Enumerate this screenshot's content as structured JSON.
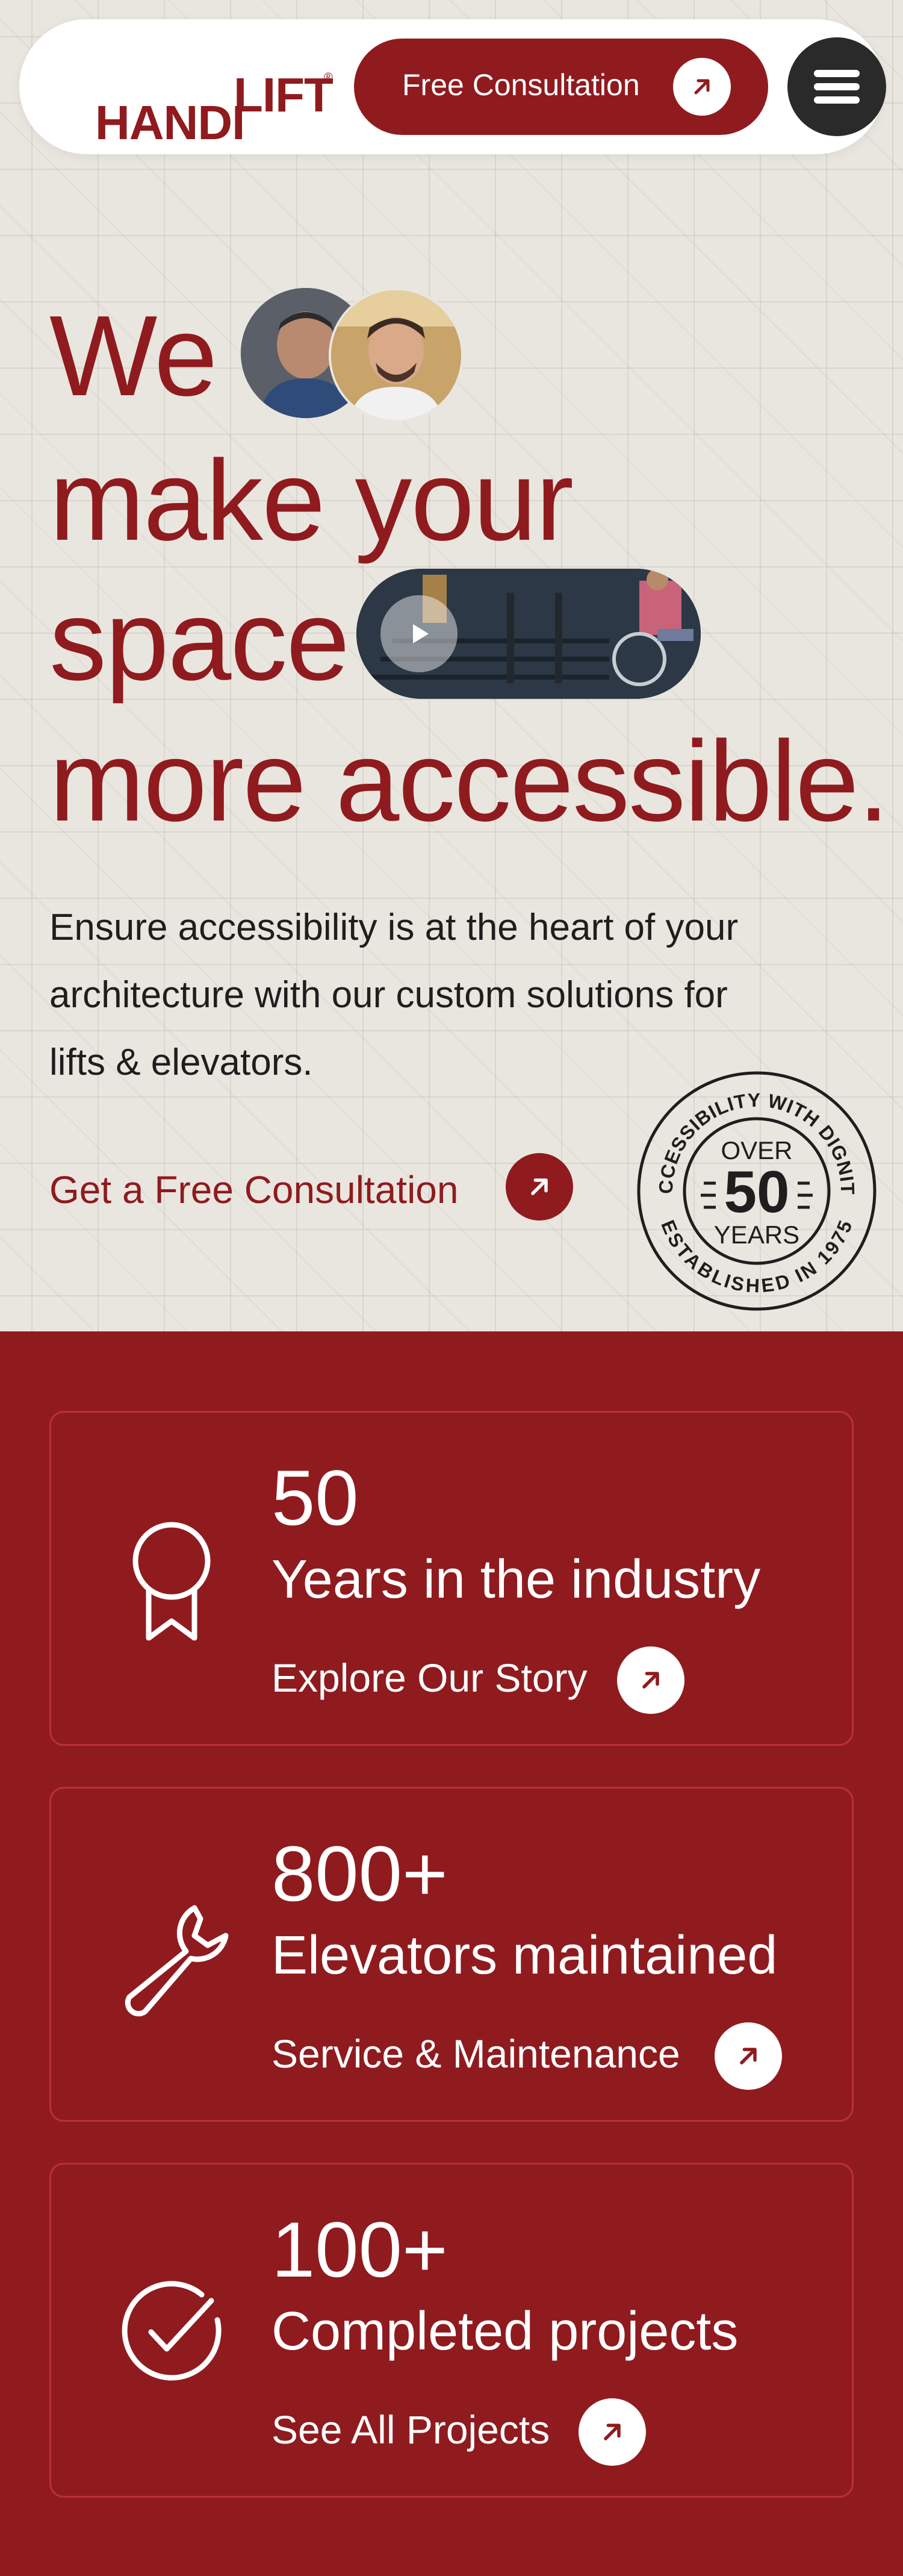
{
  "brand": {
    "logo_part1": "HANDI",
    "logo_part2": "LIFT",
    "registered": "®",
    "primary_color": "#8f1b1f"
  },
  "navbar": {
    "cta_label": "Free Consultation",
    "cta_icon": "arrow-up-right-icon",
    "menu_icon": "hamburger-menu-icon"
  },
  "hero": {
    "headline": {
      "line1": "We",
      "line2": "make your",
      "line3": "space",
      "line4": "more accessible."
    },
    "body": "Ensure accessibility is at the heart of your architecture with our custom solutions for lifts & elevators.",
    "cta_label": "Get a Free Consultation",
    "cta_icon": "arrow-up-right-icon",
    "video_icon": "play-icon"
  },
  "badge": {
    "top_text": "ACCESSIBILITY WITH DIGNITY",
    "over": "OVER",
    "number": "50",
    "years": "YEARS",
    "bottom_text": "ESTABLISHED IN 1975"
  },
  "stats": [
    {
      "icon": "award-ribbon-icon",
      "number": "50",
      "label": "Years in the industry",
      "link": "Explore Our Story"
    },
    {
      "icon": "wrench-icon",
      "number": "800+",
      "label": "Elevators maintained",
      "link": "Service & Maintenance"
    },
    {
      "icon": "check-circle-icon",
      "number": "100+",
      "label": "Completed projects",
      "link": "See All Projects"
    }
  ]
}
